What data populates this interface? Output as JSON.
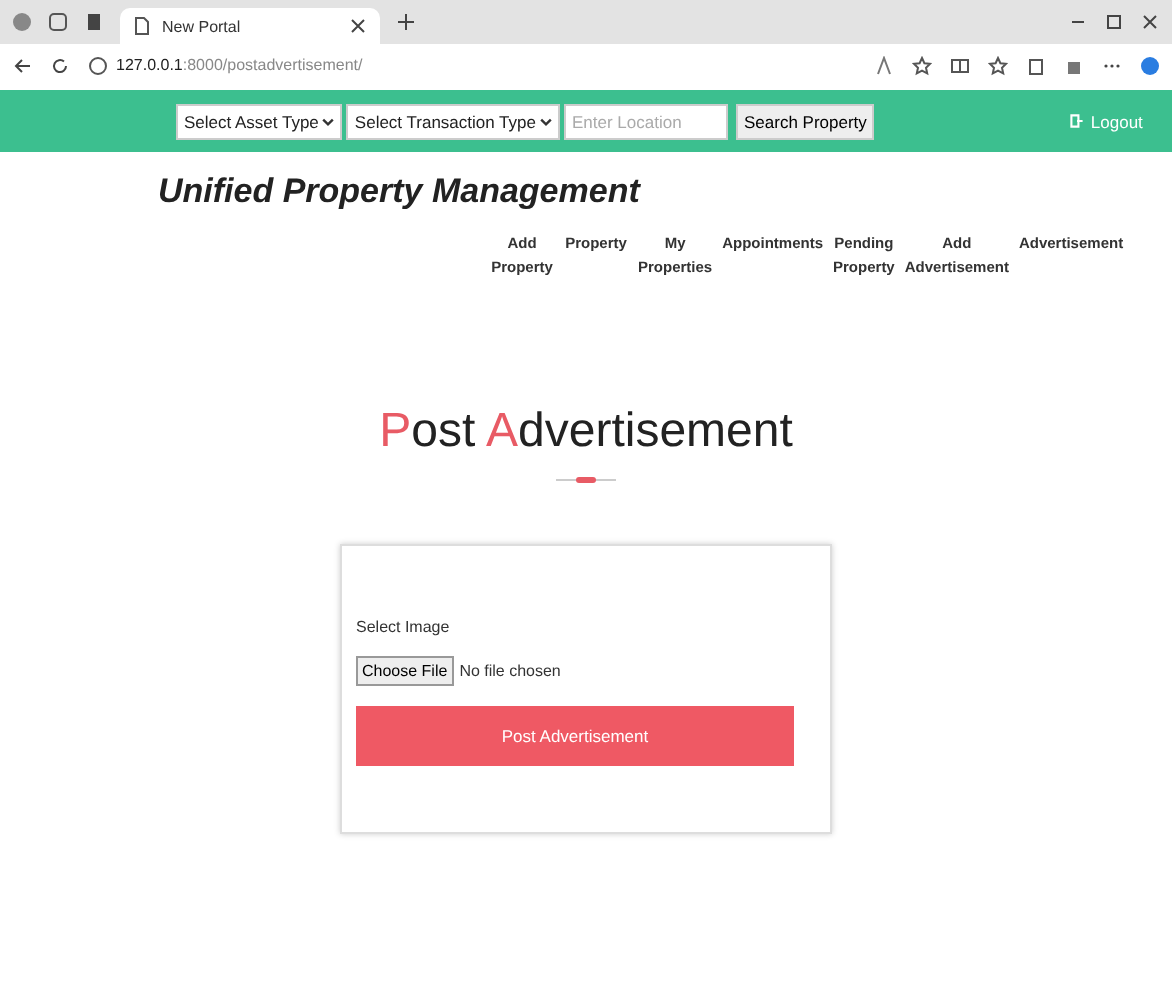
{
  "browser": {
    "tab_title": "New Portal",
    "url_host": "127.0.0.1",
    "url_path": ":8000/postadvertisement/"
  },
  "navbar": {
    "asset_type": "Select Asset Type",
    "transaction_type": "Select Transaction Type",
    "location_placeholder": "Enter Location",
    "search_button": "Search Property",
    "logout": "Logout"
  },
  "brand": "Unified Property Management",
  "menu": [
    {
      "label": "Add Property"
    },
    {
      "label": "Property"
    },
    {
      "label": "My Properties"
    },
    {
      "label": "Appointments"
    },
    {
      "label": "Pending Property"
    },
    {
      "label": "Add Advertisement"
    },
    {
      "label": "Advertisement"
    }
  ],
  "heading": [
    {
      "text": "P",
      "accent": true
    },
    {
      "text": "ost ",
      "accent": false
    },
    {
      "text": "A",
      "accent": true
    },
    {
      "text": "dvertisement",
      "accent": false
    }
  ],
  "form": {
    "label": "Select Image",
    "file_button": "Choose File",
    "file_status": "No file chosen",
    "submit": "Post Advertisement"
  }
}
